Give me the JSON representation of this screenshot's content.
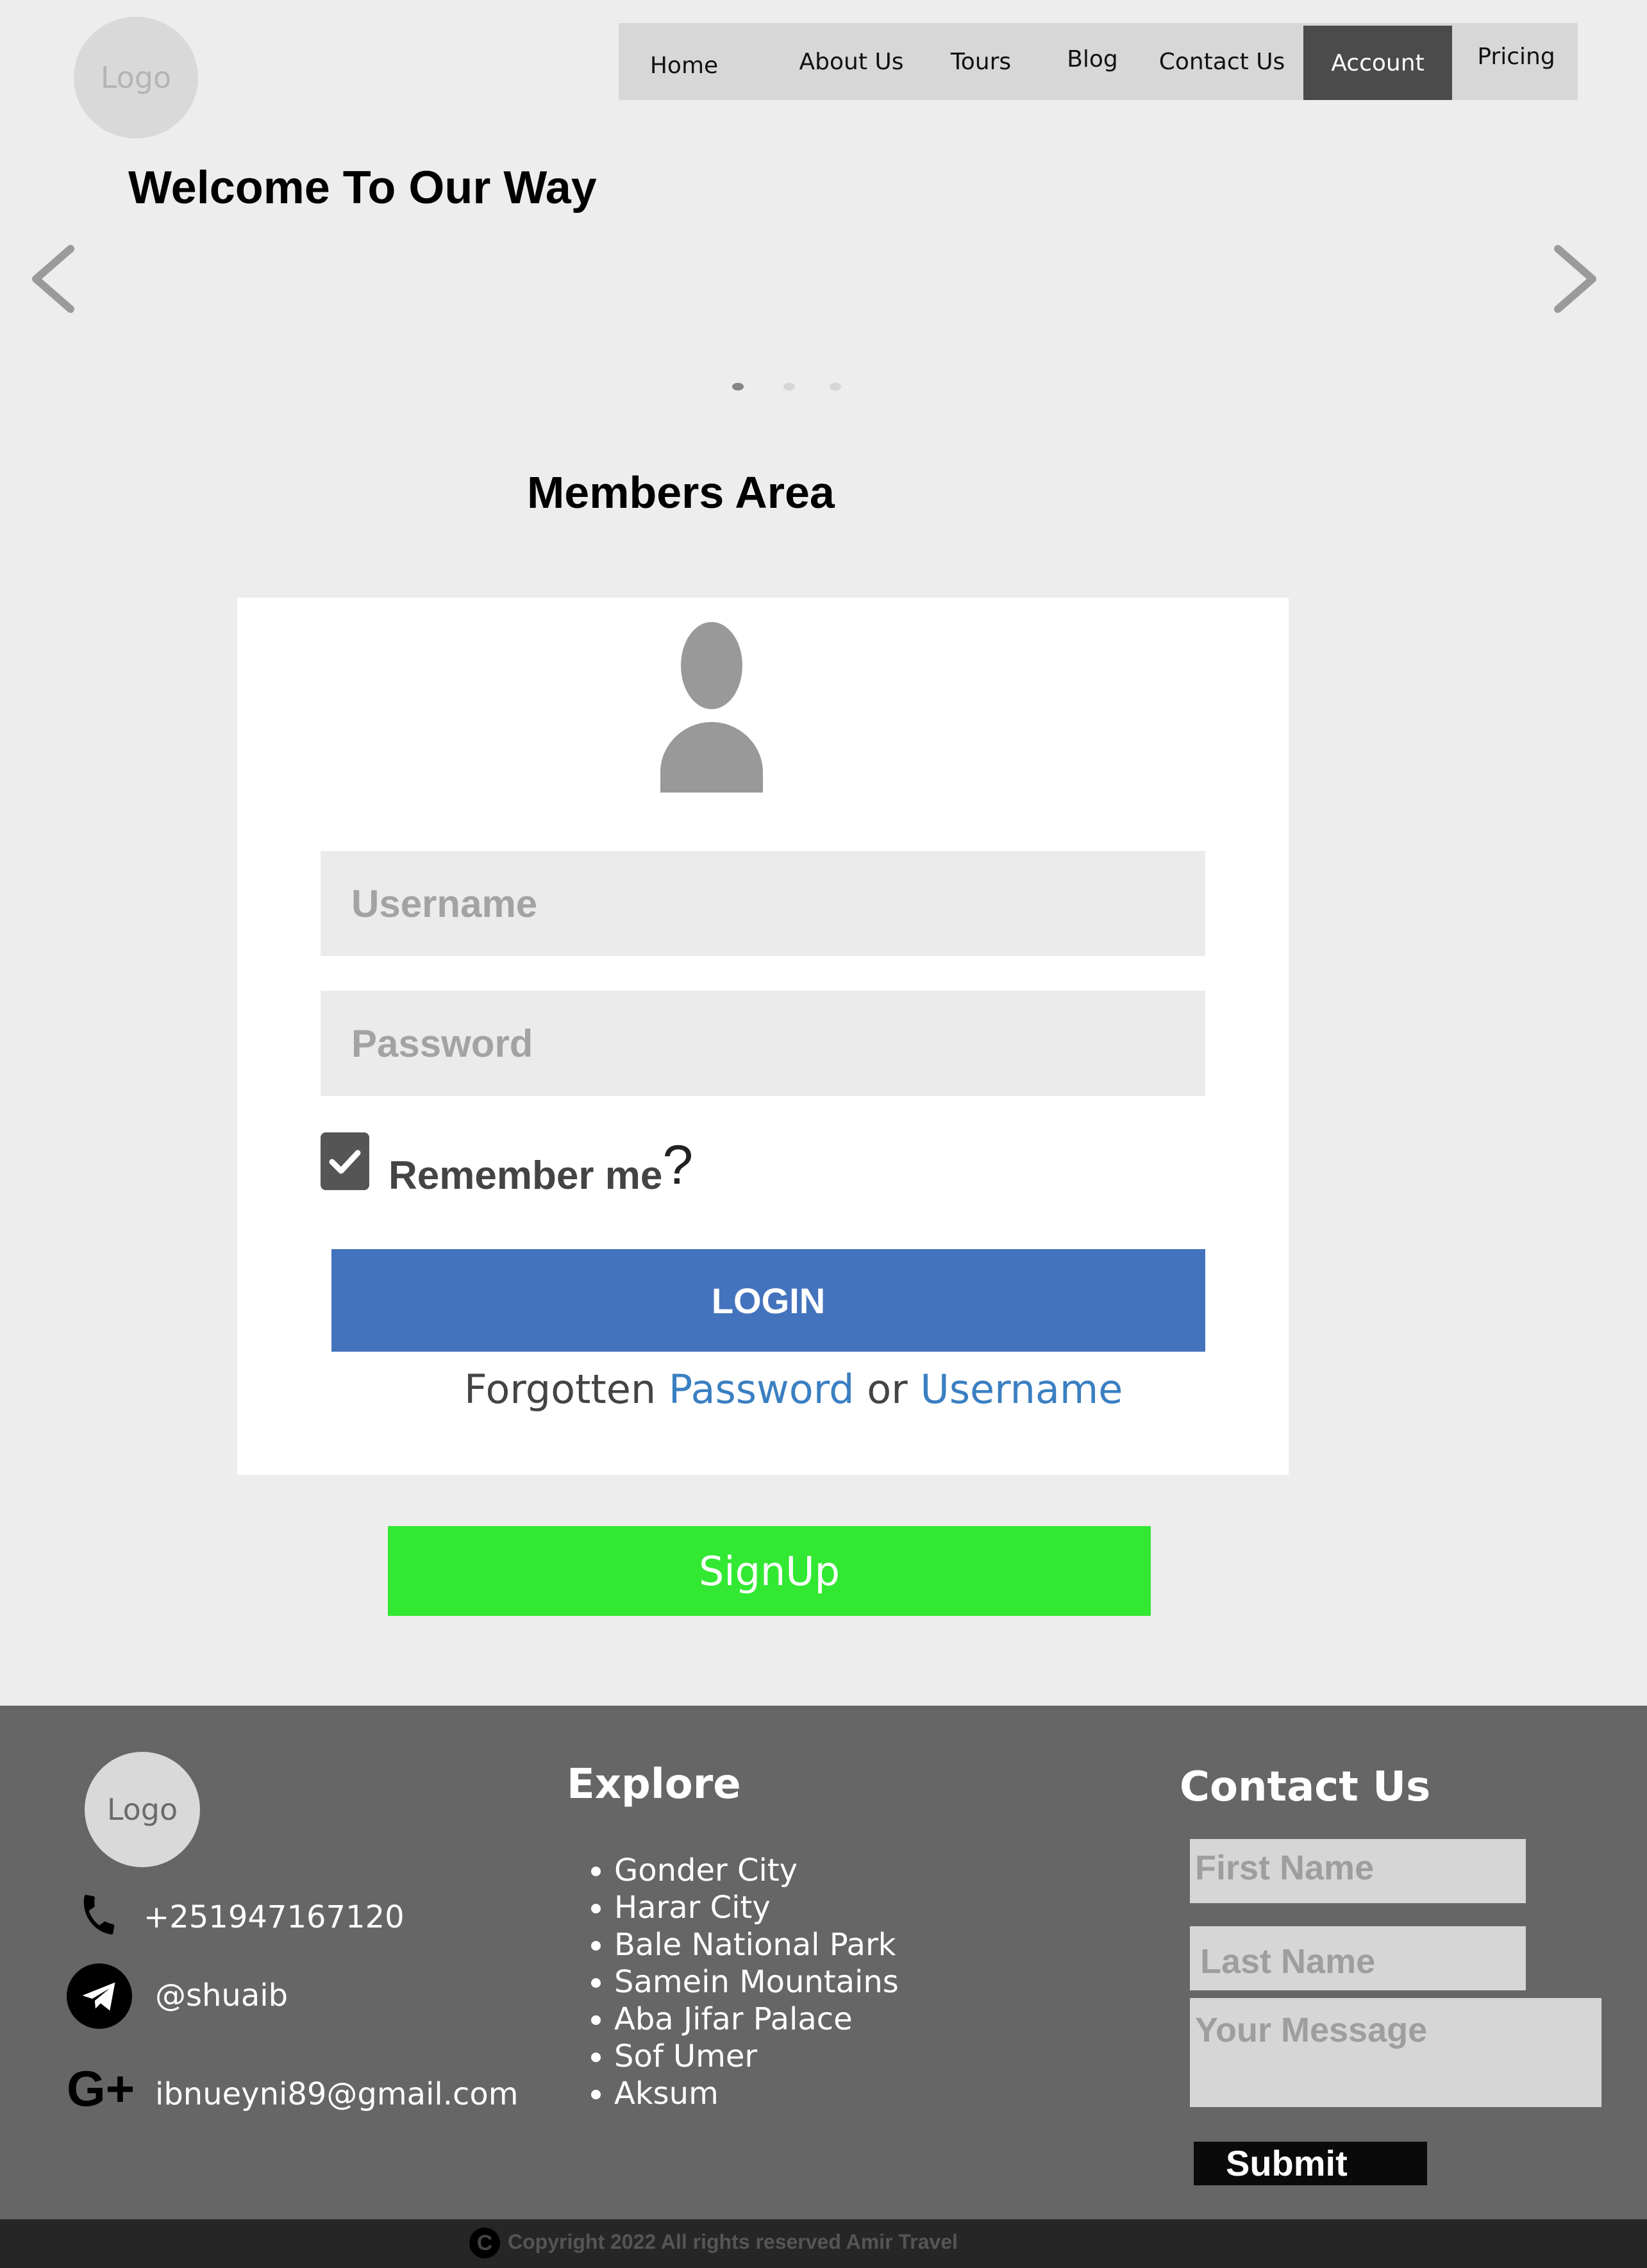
{
  "header": {
    "logo": "Logo",
    "nav": [
      "Home",
      "About Us",
      "Tours",
      "Blog",
      "Contact Us",
      "Account",
      "Pricing"
    ],
    "active_nav": "Account"
  },
  "hero": {
    "title": "Welcome To Our Way",
    "slides_total": 3,
    "active_slide": 1
  },
  "members": {
    "title": "Members Area",
    "username_placeholder": "Username",
    "password_placeholder": "Password",
    "remember_label": "Remember me",
    "remember_mark": "?",
    "remember_checked": true,
    "login_label": "LOGIN",
    "forgot_prefix": "Forgotten",
    "forgot_password": "Password",
    "forgot_or": "or",
    "forgot_username": "Username",
    "signup_label": "SignUp"
  },
  "footer": {
    "logo": "Logo",
    "phone": "+251947167120",
    "telegram": "@shuaib",
    "email": "ibnueyni89@gmail.com",
    "explore_title": "Explore",
    "explore_items": [
      "Gonder City",
      "Harar City",
      "Bale National Park",
      "Samein Mountains",
      "Aba Jifar Palace",
      "Sof Umer",
      "Aksum"
    ],
    "contact_title": "Contact Us",
    "first_name_placeholder": "First Name",
    "last_name_placeholder": "Last Name",
    "message_placeholder": "Your Message",
    "submit_label": "Submit",
    "copyright_icon": "C",
    "copyright": "Copyright 2022 All rights reserved Amir Travel"
  },
  "colors": {
    "page_bg": "#ededed",
    "nav_bg": "#d7d7d7",
    "nav_active": "#4b4b4b",
    "login_button": "#4473be",
    "link": "#3a7fc2",
    "signup_button": "#32e832",
    "footer_bg": "#666666",
    "bottom_bar": "#262626"
  }
}
